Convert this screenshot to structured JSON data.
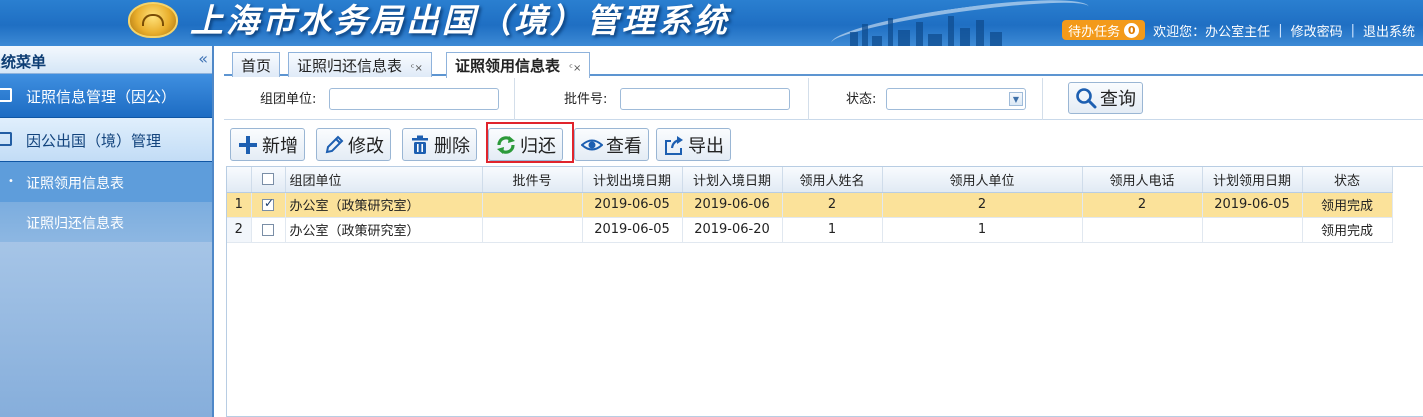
{
  "header": {
    "app_title": "上海市水务局出国（境）管理系统",
    "task_label": "待办任务",
    "task_count": "0",
    "welcome": "欢迎您：办公室主任",
    "change_password": "修改密码",
    "logout": "退出系统",
    "separator": "|"
  },
  "sidebar": {
    "title": "系统菜单",
    "collapse_icon": "«",
    "groups": [
      {
        "label": "证照信息管理（因公）"
      },
      {
        "label": "因公出国（境）管理"
      }
    ],
    "items": [
      {
        "label": "证照领用信息表",
        "active": true
      },
      {
        "label": "证照归还信息表",
        "active": false
      }
    ]
  },
  "tabs": [
    {
      "label": "首页",
      "closable": false
    },
    {
      "label": "证照归还信息表",
      "closable": true
    },
    {
      "label": "证照领用信息表",
      "closable": true,
      "active": true
    }
  ],
  "tab_close_glyph": "ᶜ×",
  "search": {
    "org_label": "组团单位:",
    "org_value": "",
    "batch_label": "批件号:",
    "batch_value": "",
    "status_label": "状态:",
    "status_value": "",
    "query_button": "查询"
  },
  "toolbar": {
    "add": "新增",
    "edit": "修改",
    "delete": "删除",
    "return": "归还",
    "view": "查看",
    "export": "导出"
  },
  "table": {
    "columns": [
      "组团单位",
      "批件号",
      "计划出境日期",
      "计划入境日期",
      "领用人姓名",
      "领用人单位",
      "领用人电话",
      "计划领用日期",
      "状态"
    ],
    "rows": [
      {
        "num": "1",
        "checked": true,
        "selected": true,
        "cells": [
          "办公室（政策研究室）",
          "",
          "2019-06-05",
          "2019-06-06",
          "2",
          "2",
          "2",
          "2019-06-05",
          "领用完成"
        ]
      },
      {
        "num": "2",
        "checked": false,
        "selected": false,
        "cells": [
          "办公室（政策研究室）",
          "",
          "2019-06-05",
          "2019-06-20",
          "1",
          "1",
          "",
          "",
          "领用完成"
        ]
      }
    ]
  },
  "colors": {
    "header_blue": "#1f6fc3",
    "selected_row": "#fbe29a",
    "task_orange": "#f39a1a",
    "highlight_red": "#e0242c"
  }
}
